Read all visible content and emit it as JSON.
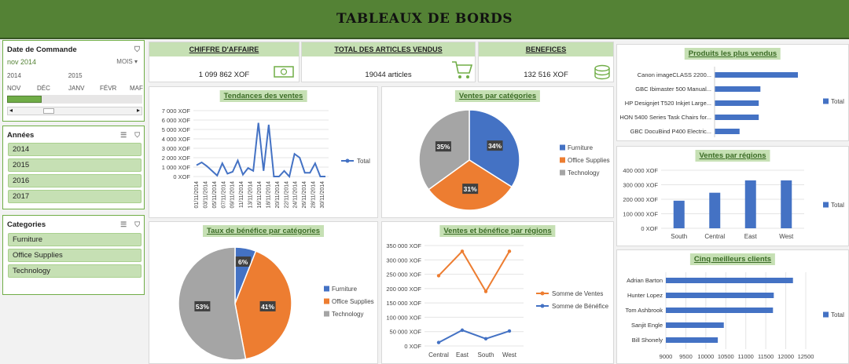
{
  "header": {
    "title": "TABLEAUX DE BORDS"
  },
  "timeline": {
    "title": "Date de Commande",
    "selected": "nov 2014",
    "level": "MOIS",
    "years": [
      "2014",
      "2015"
    ],
    "months": [
      "NOV",
      "DÉC",
      "JANV",
      "FÉVR",
      "MAF"
    ]
  },
  "years_slicer": {
    "title": "Années",
    "items": [
      "2014",
      "2015",
      "2016",
      "2017"
    ]
  },
  "categories_slicer": {
    "title": "Categories",
    "items": [
      "Furniture",
      "Office Supplies",
      "Technology"
    ]
  },
  "kpis": [
    {
      "label": "CHIFFRE D'AFFAIRE",
      "value": "1 099 862 XOF",
      "icon": "money-icon"
    },
    {
      "label": "TOTAL DES ARTICLES VENDUS",
      "value": "19044 articles",
      "icon": "cart-icon"
    },
    {
      "label": "BENEFICES",
      "value": "132 516 XOF",
      "icon": "coins-icon"
    }
  ],
  "colors": {
    "blue": "#4472c4",
    "orange": "#ed7d31",
    "gray": "#a5a5a5",
    "green": "#548235"
  },
  "chart_data": [
    {
      "id": "trend",
      "type": "line",
      "title": "Tendances des ventes",
      "x_labels": [
        "01/11/2014",
        "03/11/2014",
        "05/11/2014",
        "07/11/2014",
        "09/11/2014",
        "11/11/2014",
        "13/11/2014",
        "16/11/2014",
        "18/11/2014",
        "20/11/2014",
        "22/11/2014",
        "24/11/2014",
        "26/11/2014",
        "28/11/2014",
        "30/11/2014"
      ],
      "y_ticks": [
        "0 XOF",
        "1 000 XOF",
        "2 000 XOF",
        "3 000 XOF",
        "4 000 XOF",
        "5 000 XOF",
        "6 000 XOF",
        "7 000 XOF"
      ],
      "ylim": [
        0,
        7000
      ],
      "series": [
        {
          "name": "Total",
          "values": [
            1200,
            1500,
            1100,
            600,
            100,
            1400,
            300,
            500,
            1700,
            200,
            900,
            600,
            5700,
            600,
            5500,
            0,
            0,
            600,
            0,
            2400,
            2000,
            400,
            400,
            1400,
            0,
            0
          ]
        }
      ]
    },
    {
      "id": "cat_pie",
      "type": "pie",
      "title": "Ventes par catégories",
      "labels": [
        "Furniture",
        "Office Supplies",
        "Technology"
      ],
      "values": [
        34,
        31,
        35
      ],
      "value_labels": [
        "34%",
        "31%",
        "35%"
      ]
    },
    {
      "id": "profit_pie",
      "type": "pie",
      "title": "Taux de bénéfice par catégories",
      "labels": [
        "Furniture",
        "Office Supplies",
        "Technology"
      ],
      "values": [
        6,
        41,
        53
      ],
      "value_labels": [
        "6%",
        "41%",
        "53%"
      ]
    },
    {
      "id": "region_line",
      "type": "line",
      "title": "Ventes et bénéfice par régions",
      "categories": [
        "Central",
        "East",
        "South",
        "West"
      ],
      "y_ticks": [
        "0 XOF",
        "50 000 XOF",
        "100 000 XOF",
        "150 000 XOF",
        "200 000 XOF",
        "250 000 XOF",
        "300 000 XOF",
        "350 000 XOF"
      ],
      "ylim": [
        0,
        350000
      ],
      "series": [
        {
          "name": "Somme de Ventes",
          "values": [
            245000,
            330000,
            190000,
            330000
          ]
        },
        {
          "name": "Somme de Bénéfice",
          "values": [
            12000,
            55000,
            25000,
            52000
          ]
        }
      ]
    },
    {
      "id": "top_products",
      "type": "bar",
      "title": "Produits les plus vendus",
      "categories": [
        "Canon imageCLASS 2200...",
        "GBC Ibimaster 500 Manual...",
        "HP Designjet T520 Inkjet Large...",
        "HON 5400 Series Task Chairs for...",
        "GBC DocuBind P400 Electric..."
      ],
      "values": [
        100,
        55,
        53,
        53,
        30
      ],
      "series_name": "Total"
    },
    {
      "id": "regions_bar",
      "type": "bar",
      "title": "Ventes par régions",
      "categories": [
        "South",
        "Central",
        "East",
        "West"
      ],
      "values": [
        190000,
        245000,
        330000,
        330000
      ],
      "y_ticks": [
        "0 XOF",
        "100 000 XOF",
        "200 000 XOF",
        "300 000 XOF",
        "400 000 XOF"
      ],
      "ylim": [
        0,
        400000
      ],
      "series_name": "Total"
    },
    {
      "id": "top_clients",
      "type": "bar",
      "title": "Cinq meilleurs clients",
      "categories": [
        "Adrian Barton",
        "Hunter Lopez",
        "Tom Ashbrook",
        "Sanjit Engle",
        "Bill Shonely"
      ],
      "values": [
        12180,
        11700,
        11680,
        10450,
        10300
      ],
      "x_ticks": [
        "9000",
        "9500",
        "10000",
        "10500",
        "11000",
        "11500",
        "12000",
        "12500"
      ],
      "xlim": [
        9000,
        12500
      ],
      "series_name": "Total"
    }
  ]
}
